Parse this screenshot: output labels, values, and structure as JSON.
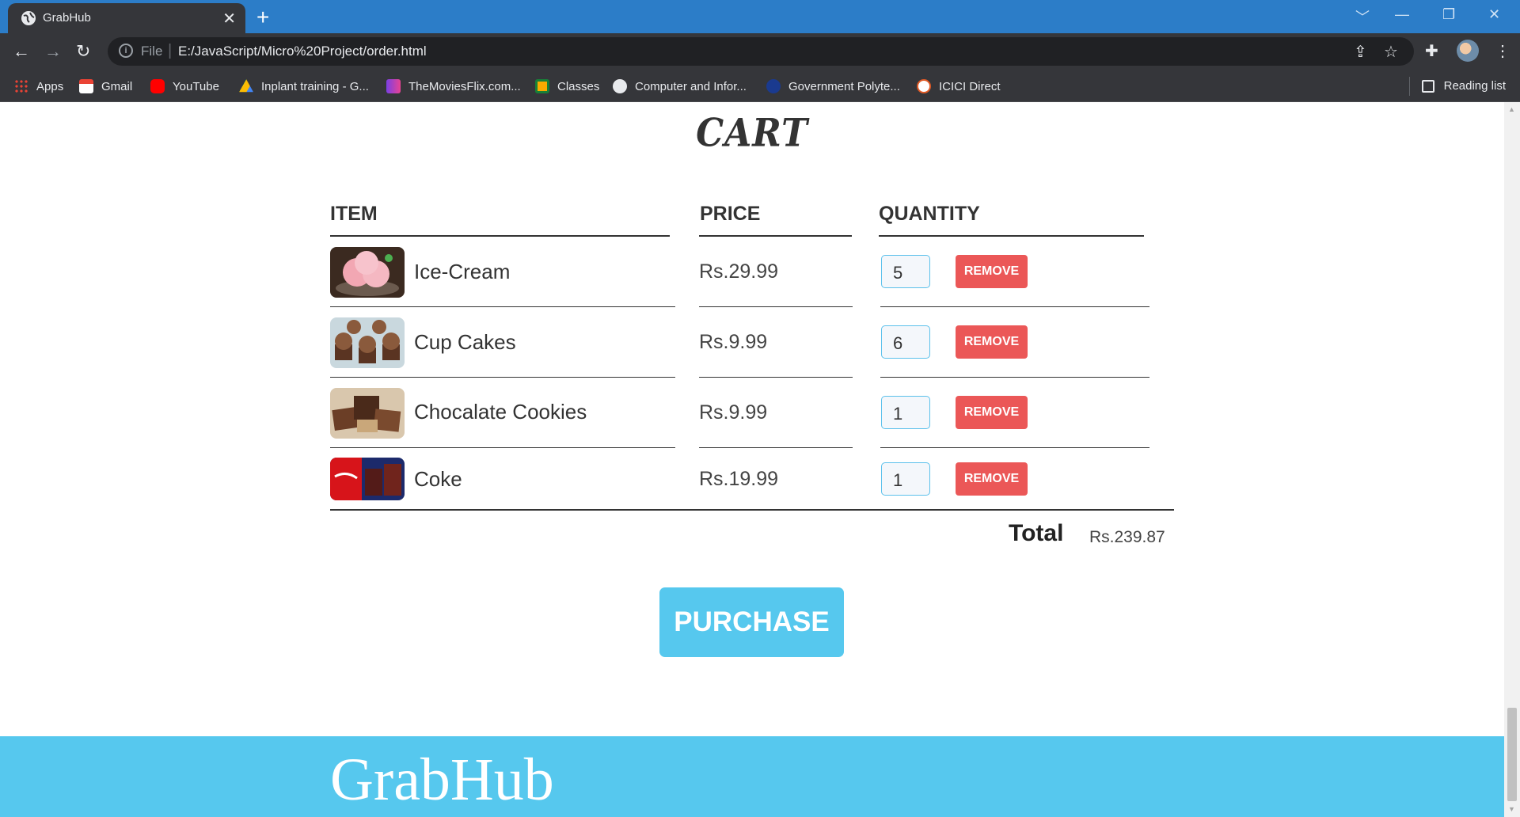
{
  "browser": {
    "tab_title": "GrabHub",
    "tab_close": "✕",
    "new_tab": "+",
    "win_controls": [
      "﹀",
      "—",
      "❐",
      "✕"
    ],
    "nav": {
      "back": "←",
      "forward": "→",
      "reload": "↻"
    },
    "address": {
      "scheme_label": "File",
      "separator": "|",
      "url": "E:/JavaScript/Micro%20Project/order.html"
    },
    "bookmarks": [
      {
        "label": "Apps",
        "icon": "apps-grid-icon",
        "color": "#ea4335"
      },
      {
        "label": "Gmail",
        "icon": "gmail-icon",
        "color": "#ea4335"
      },
      {
        "label": "YouTube",
        "icon": "youtube-icon",
        "color": "#ff0000"
      },
      {
        "label": "Inplant training - G...",
        "icon": "google-drive-icon",
        "color": "#fbbc04"
      },
      {
        "label": "TheMoviesFlix.com...",
        "icon": "moviesflix-icon",
        "color": "#7b3fe4"
      },
      {
        "label": "Classes",
        "icon": "google-classroom-icon",
        "color": "#f9ab00"
      },
      {
        "label": "Computer and Infor...",
        "icon": "globe-icon",
        "color": "#e8eaed"
      },
      {
        "label": "Government Polyte...",
        "icon": "polytechnic-icon",
        "color": "#1a3a8f"
      },
      {
        "label": "ICICI Direct",
        "icon": "icici-icon",
        "color": "#e05a26"
      }
    ],
    "reading_list": "Reading list"
  },
  "page": {
    "heading": "CART",
    "columns": {
      "item": "ITEM",
      "price": "PRICE",
      "quantity": "QUANTITY"
    },
    "items": [
      {
        "name": "Ice-Cream",
        "price": "Rs.29.99",
        "quantity": "5",
        "remove_label": "REMOVE",
        "image": "ice-cream-image"
      },
      {
        "name": "Cup Cakes",
        "price": "Rs.9.99",
        "quantity": "6",
        "remove_label": "REMOVE",
        "image": "cupcakes-image"
      },
      {
        "name": "Chocalate Cookies",
        "price": "Rs.9.99",
        "quantity": "1",
        "remove_label": "REMOVE",
        "image": "chocolate-cookies-image"
      },
      {
        "name": "Coke",
        "price": "Rs.19.99",
        "quantity": "1",
        "remove_label": "REMOVE",
        "image": "coke-image"
      }
    ],
    "total_label": "Total",
    "total_value": "Rs.239.87",
    "purchase_label": "PURCHASE",
    "footer_brand": "GrabHub",
    "colors": {
      "accent": "#56c8ee",
      "remove": "#eb5757",
      "tab_strip": "#2c7dc8"
    }
  }
}
